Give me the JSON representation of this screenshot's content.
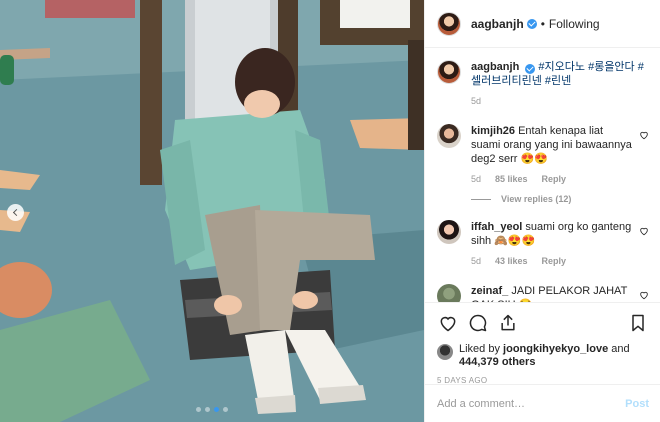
{
  "post": {
    "username": "aagbanjh",
    "follow_status": "Following",
    "separator": "•",
    "caption_tags": "#지오다노 #롱을안다 #셀러브리티린넨 #린넨",
    "caption_age": "5d"
  },
  "comments": [
    {
      "username": "kimjih26",
      "text": "Entah kenapa liat suami orang yang ini bawaannya deg2 serr 😍😍",
      "age": "5d",
      "likes": "85 likes",
      "reply": "Reply",
      "view_replies": "View replies (12)"
    },
    {
      "username": "iffah_yeol",
      "text": "suami org ko ganteng sihh 🙈😍😍",
      "age": "5d",
      "likes": "43 likes",
      "reply": "Reply"
    },
    {
      "username": "zeinaf_",
      "text": "JADI PELAKOR JAHAT GAK SIH 😂"
    }
  ],
  "likes": {
    "prefix": "Liked by",
    "first_liker": "joongkihyekyo_love",
    "conjunction": "and",
    "others": "444,379 others"
  },
  "date": "5 DAYS AGO",
  "add_comment": {
    "placeholder": "Add a comment…",
    "post_label": "Post"
  },
  "carousel": {
    "total": 4,
    "active_index": 2
  },
  "colors": {
    "accent": "#3897f0",
    "link": "#003569",
    "muted": "#999999",
    "post_disabled": "#b2dffc"
  }
}
